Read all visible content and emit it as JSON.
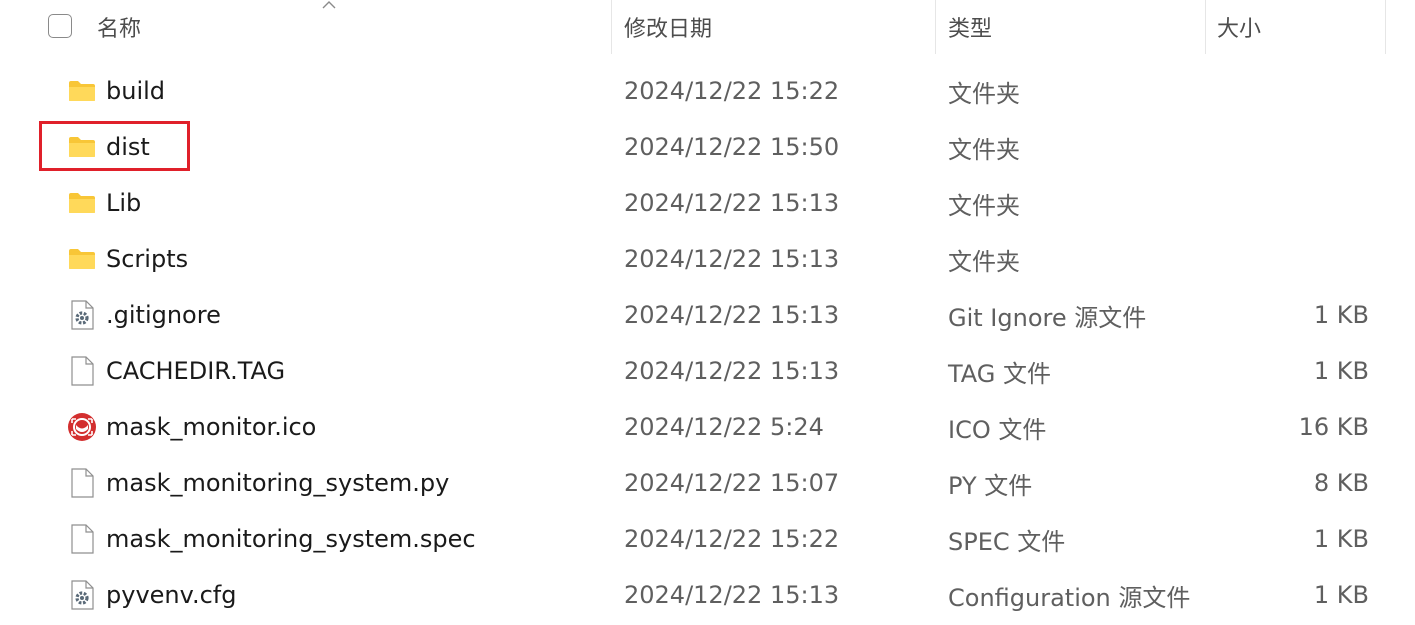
{
  "columns": {
    "name": "名称",
    "modified": "修改日期",
    "type": "类型",
    "size": "大小"
  },
  "sort": {
    "column": "name",
    "direction": "ascending"
  },
  "files": [
    {
      "name": "build",
      "modified": "2024/12/22 15:22",
      "type": "文件夹",
      "size": "",
      "icon": "folder-icon"
    },
    {
      "name": "dist",
      "modified": "2024/12/22 15:50",
      "type": "文件夹",
      "size": "",
      "icon": "folder-icon",
      "highlighted": true
    },
    {
      "name": "Lib",
      "modified": "2024/12/22 15:13",
      "type": "文件夹",
      "size": "",
      "icon": "folder-icon"
    },
    {
      "name": "Scripts",
      "modified": "2024/12/22 15:13",
      "type": "文件夹",
      "size": "",
      "icon": "folder-icon"
    },
    {
      "name": ".gitignore",
      "modified": "2024/12/22 15:13",
      "type": "Git Ignore 源文件",
      "size": "1 KB",
      "icon": "settings-file-icon"
    },
    {
      "name": "CACHEDIR.TAG",
      "modified": "2024/12/22 15:13",
      "type": "TAG 文件",
      "size": "1 KB",
      "icon": "blank-file-icon"
    },
    {
      "name": "mask_monitor.ico",
      "modified": "2024/12/22 5:24",
      "type": "ICO 文件",
      "size": "16 KB",
      "icon": "ico-image-icon"
    },
    {
      "name": "mask_monitoring_system.py",
      "modified": "2024/12/22 15:07",
      "type": "PY 文件",
      "size": "8 KB",
      "icon": "blank-file-icon"
    },
    {
      "name": "mask_monitoring_system.spec",
      "modified": "2024/12/22 15:22",
      "type": "SPEC 文件",
      "size": "1 KB",
      "icon": "blank-file-icon"
    },
    {
      "name": "pyvenv.cfg",
      "modified": "2024/12/22 15:13",
      "type": "Configuration 源文件",
      "size": "1 KB",
      "icon": "settings-file-icon"
    }
  ],
  "colors": {
    "folder": "#F8C637",
    "highlight": "#E0202A",
    "ico_badge": "#D32F2F"
  }
}
